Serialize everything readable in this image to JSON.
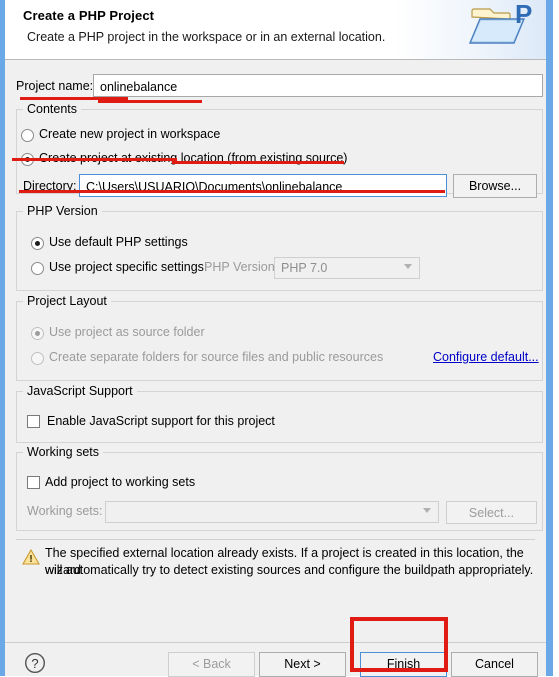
{
  "dialog": {
    "title": "Create a PHP Project",
    "subtitle": "Create a PHP project in the workspace or in an external location.",
    "icon": "php-project-folder-icon"
  },
  "project_name": {
    "label": "Project name:",
    "value": "onlinebalance",
    "placeholder": ""
  },
  "contents": {
    "group_title": "Contents",
    "option_workspace": "Create new project in workspace",
    "option_existing": "Create project at existing location (from existing source)",
    "selected": "existing",
    "directory_label": "Directory:",
    "directory_value": "C:\\Users\\USUARIO\\Documents\\onlinebalance",
    "browse_label": "Browse..."
  },
  "php_version": {
    "group_title": "PHP Version",
    "option_default": "Use default PHP settings",
    "option_specific": "Use project specific settings:",
    "selected": "default",
    "version_label": "PHP Version:",
    "version_value": "PHP 7.0"
  },
  "project_layout": {
    "group_title": "Project Layout",
    "option_source_folder": "Use project as source folder",
    "option_separate_folders": "Create separate folders for source files and public resources",
    "selected": "source_folder",
    "configure_link": "Configure default..."
  },
  "javascript_support": {
    "group_title": "JavaScript Support",
    "checkbox_label": "Enable JavaScript support for this project",
    "checked": false
  },
  "working_sets": {
    "group_title": "Working sets",
    "checkbox_label": "Add project to working sets",
    "checked": false,
    "combo_label": "Working sets:",
    "combo_value": "",
    "select_label": "Select..."
  },
  "status": {
    "icon": "warning-icon",
    "message_line1": "The specified external location already exists. If a project is created in this location, the wizard",
    "message_line2": "will automatically try to detect existing sources and configure the buildpath appropriately."
  },
  "footer": {
    "help_icon": "help-question-icon",
    "back_label": "< Back",
    "next_label": "Next >",
    "finish_label": "Finish",
    "cancel_label": "Cancel"
  },
  "colors": {
    "annotation_red": "#e01b14",
    "window_border_blue": "#6aa8e8",
    "link_blue": "#0000c8",
    "focus_blue": "#4a90d9"
  }
}
